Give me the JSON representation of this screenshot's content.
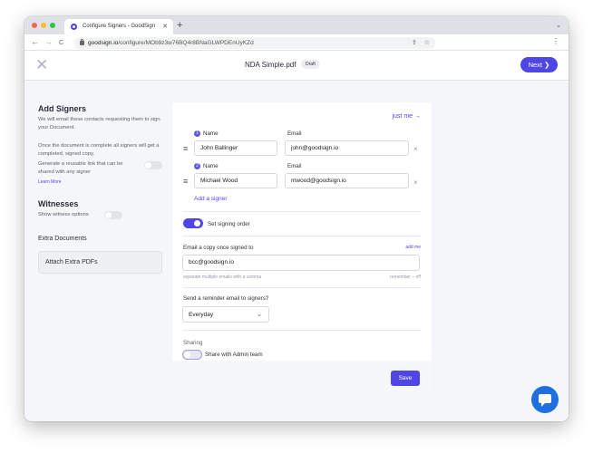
{
  "browser": {
    "tab_title": "Configure Signers - GoodSign",
    "tab_close": "✕",
    "new_tab": "+",
    "tab_menu": "⌄",
    "nav_back": "←",
    "nav_forward": "→",
    "nav_reload": "C",
    "url_host": "goodsign.io",
    "url_path": "/configure/MOb9z3w76BQ4r8BNaGLWPDEnUyKZd",
    "share_icon": "⇪",
    "bookmark_icon": "☆",
    "menu_icon": "⋮",
    "traffic_colors": [
      "#ff5f57",
      "#febc2e",
      "#28c840"
    ]
  },
  "header": {
    "close_icon": "✕",
    "document_title": "NDA Simple.pdf",
    "status_badge": "Draft",
    "next_label": "Next ❯"
  },
  "sidebar": {
    "add_signers_title": "Add Signers",
    "add_signers_desc": "We will email these contacts requesting them to sign your Document.",
    "completion_note": "Once the document is complete all signers will get a completed, signed copy.",
    "reusable_link_text": "Generate a reusable link that can be shared with any signer",
    "reusable_link_enabled": false,
    "learn_more": "Learn More",
    "witnesses_title": "Witnesses",
    "witness_option": "Show witness options",
    "witness_enabled": false,
    "extra_docs_title": "Extra Documents",
    "attach_button": "Attach Extra PDFs"
  },
  "signers": {
    "just_me": "just me →",
    "drag_icon": "≡",
    "remove_icon": "×",
    "name_label": "Name",
    "email_label": "Email",
    "list": [
      {
        "number": "1",
        "name": "John Ballinger",
        "email": "john@goodsign.io"
      },
      {
        "number": "2",
        "name": "Michael Wood",
        "email": "mwood@goodsign.io"
      }
    ],
    "add_signer": "Add a signer",
    "signing_order_label": "Set signing order",
    "signing_order_enabled": true
  },
  "copy_email": {
    "label": "Email a copy once signed to",
    "add_me": "add me",
    "value": "bcc@goodsign.io",
    "hint": "separate multiple emails with a comma",
    "remember": "remember – off"
  },
  "reminder": {
    "label": "Send a reminder email to signers?",
    "selected": "Everyday",
    "chevron": "⌄"
  },
  "sharing": {
    "label": "Sharing",
    "option": "Share with Admin team",
    "enabled": false
  },
  "actions": {
    "save": "Save"
  },
  "colors": {
    "accent": "#4f46e5",
    "chat": "#1f6fe0"
  },
  "chat_icon": "chat-bubble-icon"
}
